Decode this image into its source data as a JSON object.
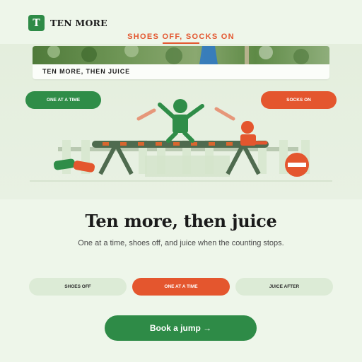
{
  "brand": {
    "logo_letter": "T",
    "name": "TEN MORE"
  },
  "header": {
    "tagline": "SHOES OFF, SOCKS ON"
  },
  "hero": {
    "caption": "TEN MORE, THEN JUICE",
    "left_pill": "ONE AT A TIME",
    "right_pill": "SOCKS ON"
  },
  "main": {
    "title": "Ten more, then juice",
    "subtitle": "One at a time, shoes off, and juice when the counting stops."
  },
  "tabs": [
    {
      "label": "SHOES OFF",
      "active": false
    },
    {
      "label": "ONE AT A TIME",
      "active": true
    },
    {
      "label": "JUICE AFTER",
      "active": false
    }
  ],
  "cta": {
    "label": "Book a jump →"
  },
  "colors": {
    "green": "#2e8b47",
    "orange": "#e4562e",
    "background": "#eef6ea"
  }
}
